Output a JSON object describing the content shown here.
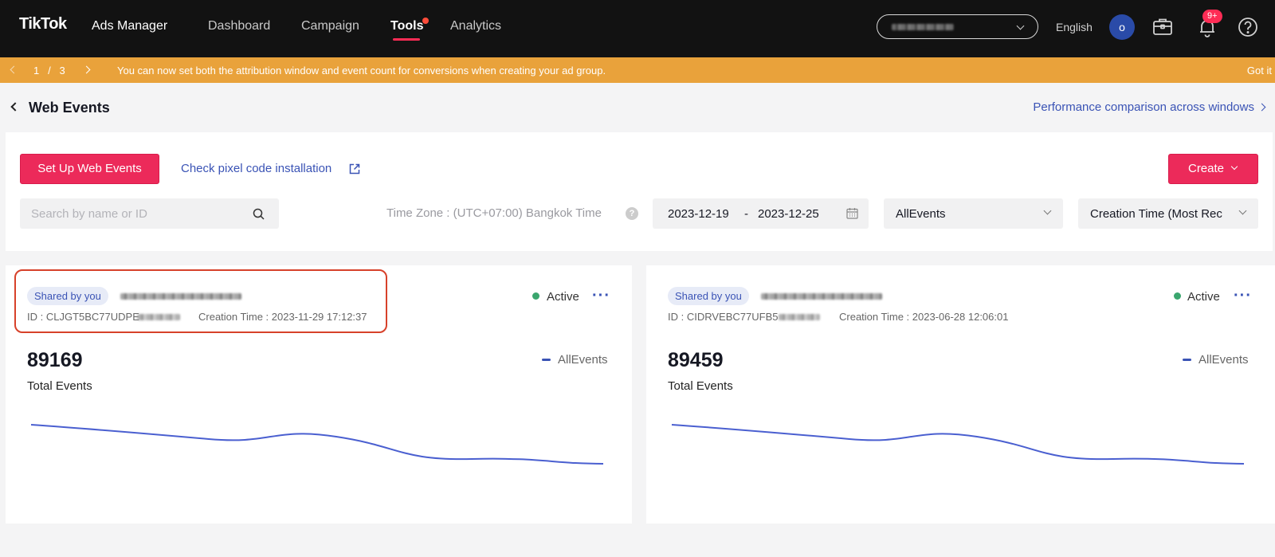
{
  "app": {
    "brand": "TikTok",
    "product": "Ads Manager"
  },
  "nav": {
    "items": [
      {
        "label": "Dashboard"
      },
      {
        "label": "Campaign"
      },
      {
        "label": "Tools"
      },
      {
        "label": "Analytics"
      }
    ],
    "active": "Tools",
    "language": "English",
    "avatar_initial": "o",
    "notification_badge": "9+"
  },
  "banner": {
    "page": "1",
    "page_sep": "/",
    "total": "3",
    "message": "You can now set both the attribution window and event count for conversions when creating your ad group.",
    "dismiss": "Got it"
  },
  "page": {
    "title": "Web Events",
    "compare_link": "Performance comparison across windows"
  },
  "toolbar": {
    "setup_button": "Set Up Web Events",
    "check_link": "Check pixel code installation",
    "create_button": "Create",
    "search_placeholder": "Search by name or ID",
    "timezone": "Time Zone : (UTC+07:00) Bangkok Time",
    "date_from": "2023-12-19",
    "date_sep": "-",
    "date_to": "2023-12-25",
    "event_filter": "AllEvents",
    "sort": "Creation Time (Most Rec"
  },
  "cards": [
    {
      "tag": "Shared by you",
      "id": "ID : CLJGT5BC77UDPE",
      "created": "Creation Time : 2023-11-29 17:12:37",
      "status": "Active",
      "total": "89169",
      "total_label": "Total Events",
      "legend": "AllEvents"
    },
    {
      "tag": "Shared by you",
      "id": "ID : CIDRVEBC77UFB5",
      "created": "Creation Time : 2023-06-28 12:06:01",
      "status": "Active",
      "total": "89459",
      "total_label": "Total Events",
      "legend": "AllEvents"
    }
  ],
  "colors": {
    "accent": "#ec2a5a",
    "link": "#3a53b5",
    "banner": "#e9a23b",
    "status_active": "#3aa66e",
    "highlight": "#d7412a"
  }
}
